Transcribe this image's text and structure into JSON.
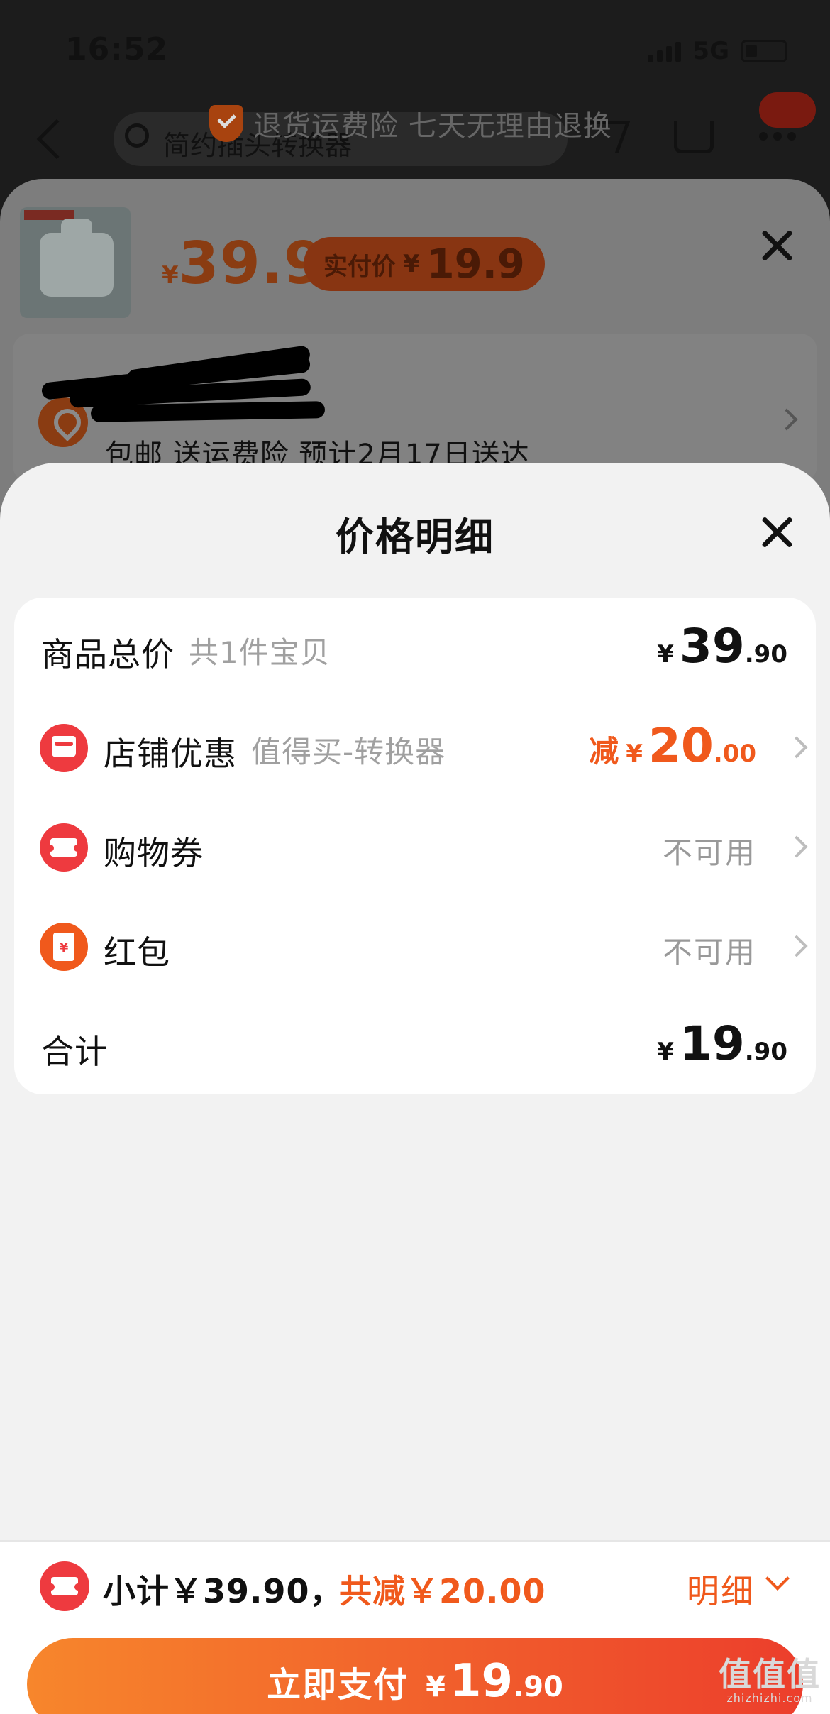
{
  "status_bar": {
    "time": "16:52",
    "network": "5G"
  },
  "background_page": {
    "search_placeholder": "简约插头转换器",
    "banner_text": "退货运费险 七天无理由退换"
  },
  "product_sheet": {
    "price_currency": "¥",
    "price": "39.9",
    "paid_label": "实付价",
    "paid_currency": "¥",
    "paid_price": "19.9",
    "address_summary": "包邮 送运费险 预计2月17日送达"
  },
  "price_detail": {
    "title": "价格明细",
    "rows": [
      {
        "label": "商品总价",
        "sub": "共1件宝贝",
        "currency": "¥",
        "int": "39",
        "dec": ".90"
      },
      {
        "label": "店铺优惠",
        "sub": "值得买-转换器",
        "prefix": "减",
        "currency": "¥",
        "int": "20",
        "dec": ".00",
        "icon": "shop-icon"
      },
      {
        "label": "购物券",
        "status": "不可用",
        "icon": "coupon-icon"
      },
      {
        "label": "红包",
        "status": "不可用",
        "icon": "red-packet-icon",
        "icon_glyph": "¥"
      },
      {
        "label": "合计",
        "currency": "¥",
        "int": "19",
        "dec": ".90"
      }
    ]
  },
  "bottom_bar": {
    "subtotal": "小计￥39.90，",
    "savings": "共减￥20.00",
    "detail_label": "明细",
    "pay_label": "立即支付",
    "pay_currency": "¥",
    "pay_int": "19",
    "pay_dec": ".90"
  },
  "watermark": {
    "brand": "值值值",
    "site": "zhizhizhi.com"
  },
  "colors": {
    "accent": "#f0591c",
    "icon_red": "#ee3a3f",
    "panel_bg": "#f2f2f2"
  }
}
